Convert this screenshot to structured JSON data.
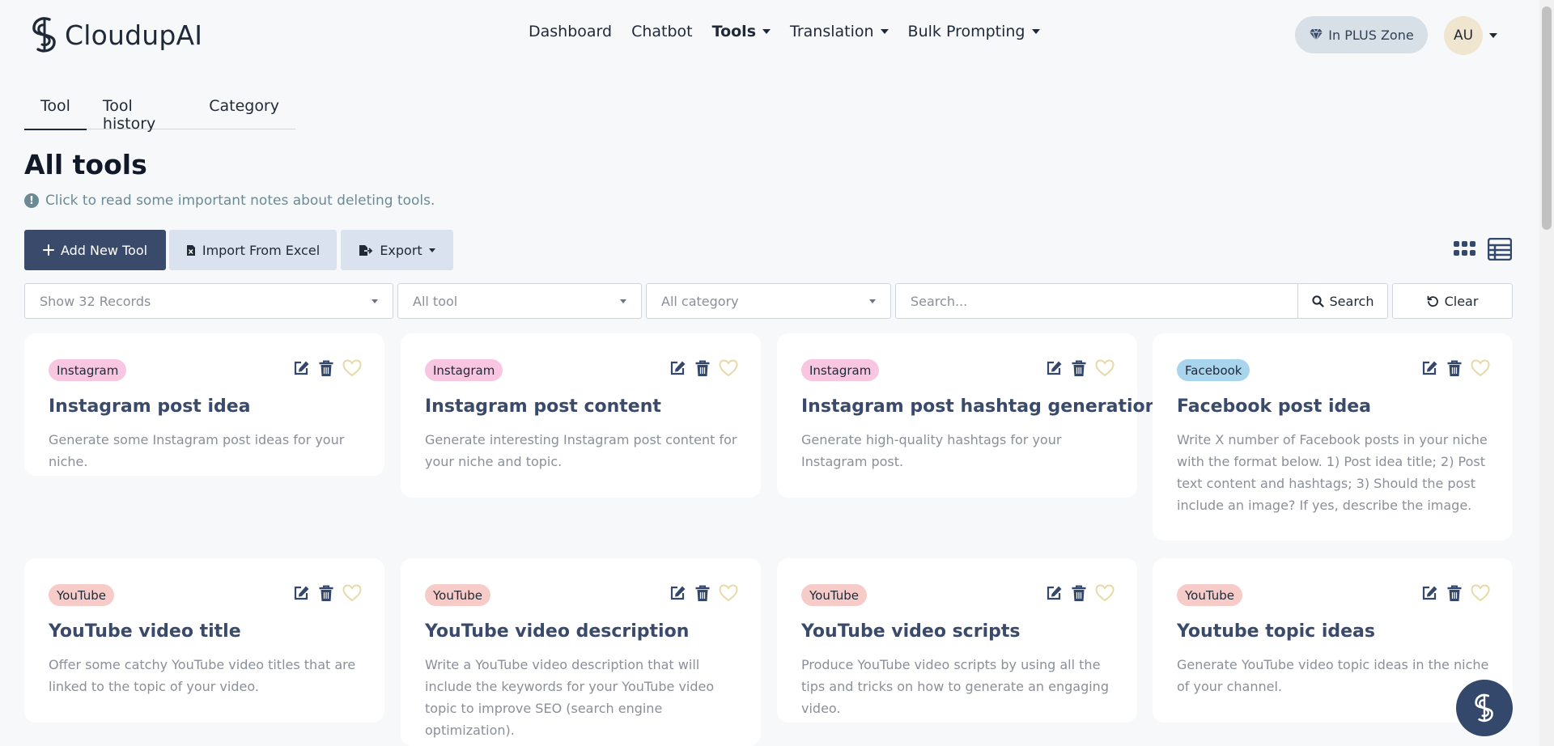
{
  "brand": {
    "name": "CloudupAI"
  },
  "nav": {
    "items": [
      {
        "label": "Dashboard",
        "dropdown": false,
        "active": false
      },
      {
        "label": "Chatbot",
        "dropdown": false,
        "active": false
      },
      {
        "label": "Tools",
        "dropdown": true,
        "active": true
      },
      {
        "label": "Translation",
        "dropdown": true,
        "active": false
      },
      {
        "label": "Bulk Prompting",
        "dropdown": true,
        "active": false
      }
    ]
  },
  "header": {
    "plus_zone_label": "In PLUS Zone",
    "avatar_initials": "AU"
  },
  "tabs": [
    {
      "label": "Tool",
      "active": true
    },
    {
      "label": "Tool history",
      "active": false
    },
    {
      "label": "Category",
      "active": false
    }
  ],
  "page": {
    "title": "All tools",
    "notice": "Click to read some important notes about deleting tools."
  },
  "actions": {
    "add_label": "Add New Tool",
    "import_label": "Import From Excel",
    "export_label": "Export"
  },
  "filters": {
    "records": "Show 32 Records",
    "tool": "All tool",
    "category": "All category",
    "search_placeholder": "Search...",
    "search_button": "Search",
    "clear_button": "Clear"
  },
  "tools": [
    {
      "tag": "Instagram",
      "tag_color": "#f8c6e0",
      "title": "Instagram post idea",
      "description": "Generate some Instagram post ideas for your niche."
    },
    {
      "tag": "Instagram",
      "tag_color": "#f8c6e0",
      "title": "Instagram post content",
      "description": "Generate interesting Instagram post content for your niche and topic."
    },
    {
      "tag": "Instagram",
      "tag_color": "#f8c6e0",
      "title": "Instagram post hashtag generation",
      "description": "Generate high-quality hashtags for your Instagram post."
    },
    {
      "tag": "Facebook",
      "tag_color": "#a9d4ee",
      "title": "Facebook post idea",
      "description": "Write X number of Facebook posts in your niche with the format below. 1) Post idea title; 2) Post text content and hashtags; 3) Should the post include an image? If yes, describe the image."
    },
    {
      "tag": "YouTube",
      "tag_color": "#f7cbc7",
      "title": "YouTube video title",
      "description": "Offer some catchy YouTube video titles that are linked to the topic of your video."
    },
    {
      "tag": "YouTube",
      "tag_color": "#f7cbc7",
      "title": "YouTube video description",
      "description": "Write a YouTube video description that will include the keywords for your YouTube video topic to improve SEO (search engine optimization)."
    },
    {
      "tag": "YouTube",
      "tag_color": "#f7cbc7",
      "title": "YouTube video scripts",
      "description": "Produce YouTube video scripts by using all the tips and tricks on how to generate an engaging video."
    },
    {
      "tag": "YouTube",
      "tag_color": "#f7cbc7",
      "title": "Youtube topic ideas",
      "description": "Generate YouTube video topic ideas in the niche of your channel."
    }
  ],
  "colors": {
    "primary": "#3a4a6b",
    "secondary_button": "#d9e2ee",
    "heart": "#e8d9a8",
    "muted_text": "#8a8f98"
  }
}
